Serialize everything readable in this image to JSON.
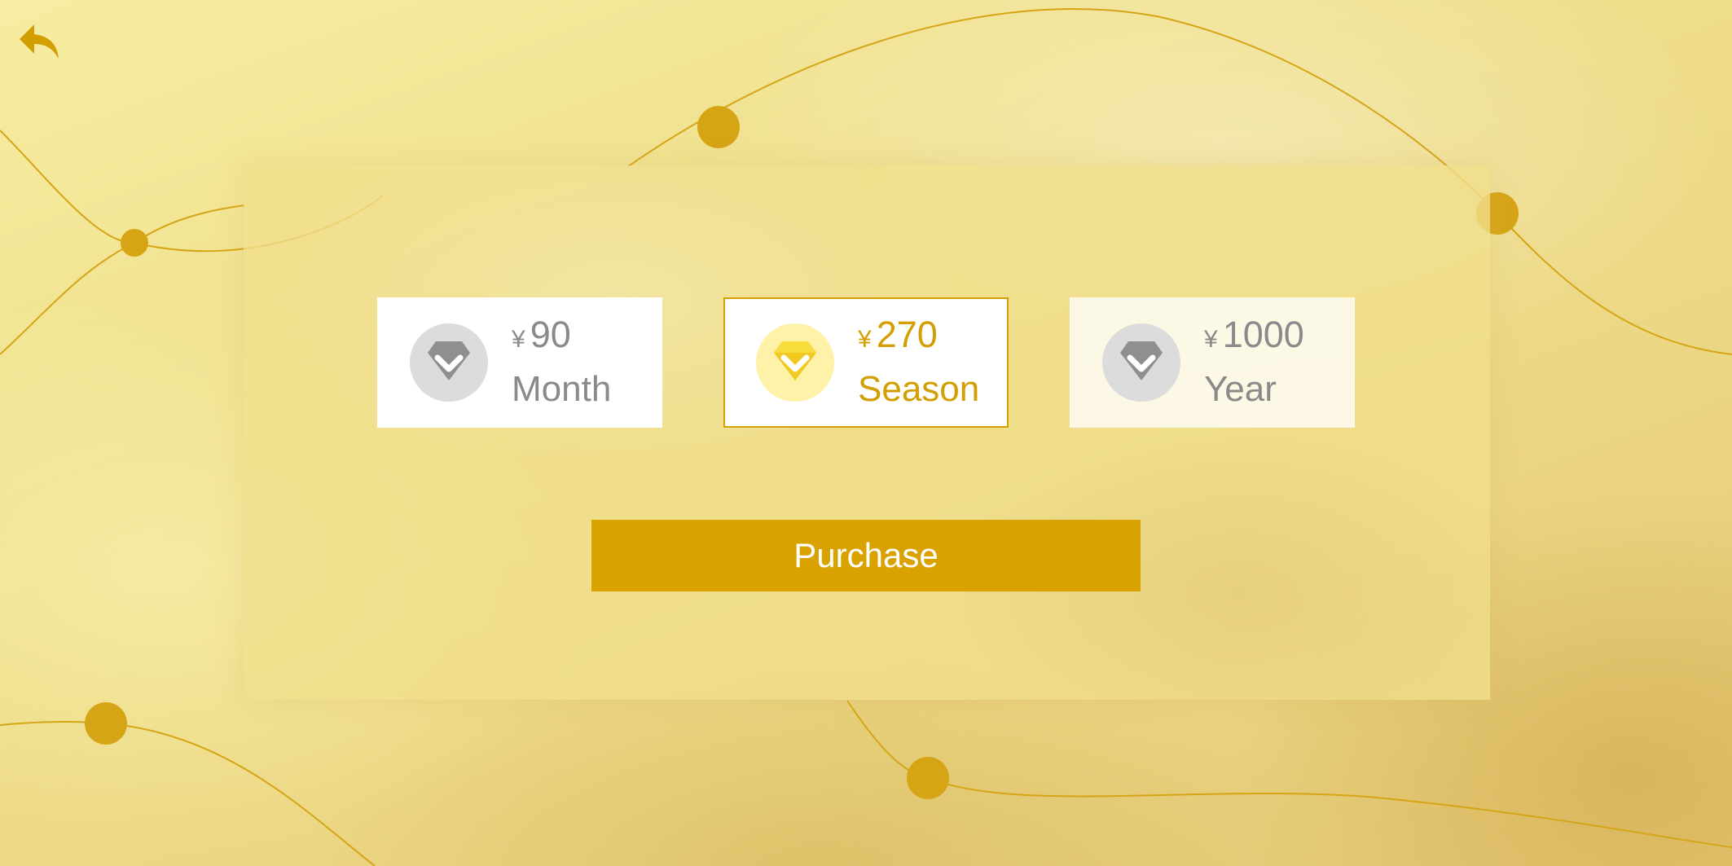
{
  "colors": {
    "accent": "#d9a200",
    "line": "#d6a516",
    "muted_text": "#8a8a8a",
    "card_bg": "#ffffff"
  },
  "header": {
    "back_icon": "back-arrow-icon"
  },
  "plans": [
    {
      "currency": "¥",
      "amount": "90",
      "label": "Month",
      "icon": "diamond-icon",
      "selected": false
    },
    {
      "currency": "¥",
      "amount": "270",
      "label": "Season",
      "icon": "diamond-icon",
      "selected": true
    },
    {
      "currency": "¥",
      "amount": "1000",
      "label": "Year",
      "icon": "diamond-icon",
      "selected": false
    }
  ],
  "actions": {
    "purchase_label": "Purchase"
  }
}
